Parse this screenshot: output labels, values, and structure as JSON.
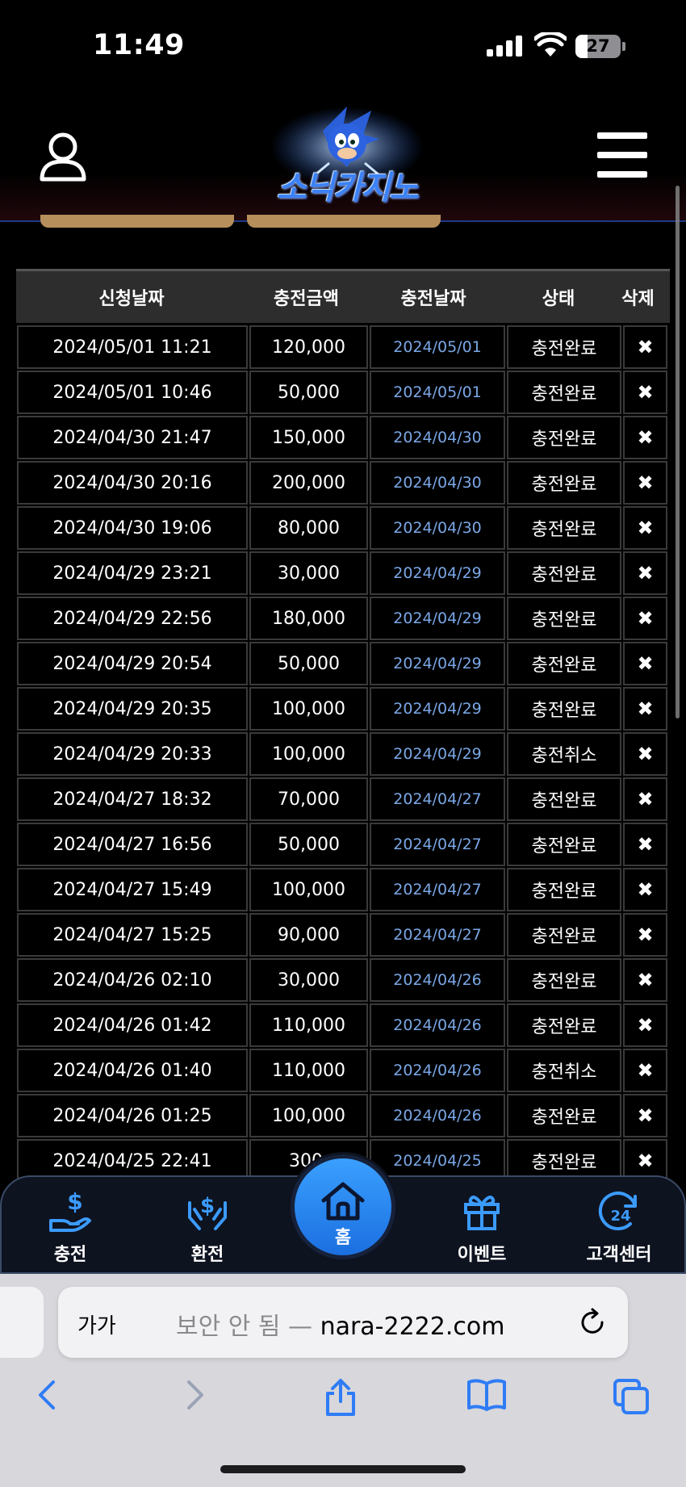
{
  "status_bar": {
    "time": "11:49",
    "battery": "27",
    "battery_level": 0.27
  },
  "header": {
    "logo_text": "소닉카지노"
  },
  "table": {
    "columns": [
      "신청날짜",
      "충전금액",
      "충전날짜",
      "상태",
      "삭제"
    ],
    "delete_symbol": "✖",
    "rows": [
      [
        "2024/05/01 11:21",
        "120,000",
        "2024/05/01",
        "충전완료"
      ],
      [
        "2024/05/01 10:46",
        "50,000",
        "2024/05/01",
        "충전완료"
      ],
      [
        "2024/04/30 21:47",
        "150,000",
        "2024/04/30",
        "충전완료"
      ],
      [
        "2024/04/30 20:16",
        "200,000",
        "2024/04/30",
        "충전완료"
      ],
      [
        "2024/04/30 19:06",
        "80,000",
        "2024/04/30",
        "충전완료"
      ],
      [
        "2024/04/29 23:21",
        "30,000",
        "2024/04/29",
        "충전완료"
      ],
      [
        "2024/04/29 22:56",
        "180,000",
        "2024/04/29",
        "충전완료"
      ],
      [
        "2024/04/29 20:54",
        "50,000",
        "2024/04/29",
        "충전완료"
      ],
      [
        "2024/04/29 20:35",
        "100,000",
        "2024/04/29",
        "충전완료"
      ],
      [
        "2024/04/29 20:33",
        "100,000",
        "2024/04/29",
        "충전취소"
      ],
      [
        "2024/04/27 18:32",
        "70,000",
        "2024/04/27",
        "충전완료"
      ],
      [
        "2024/04/27 16:56",
        "50,000",
        "2024/04/27",
        "충전완료"
      ],
      [
        "2024/04/27 15:49",
        "100,000",
        "2024/04/27",
        "충전완료"
      ],
      [
        "2024/04/27 15:25",
        "90,000",
        "2024/04/27",
        "충전완료"
      ],
      [
        "2024/04/26 02:10",
        "30,000",
        "2024/04/26",
        "충전완료"
      ],
      [
        "2024/04/26 01:42",
        "110,000",
        "2024/04/26",
        "충전완료"
      ],
      [
        "2024/04/26 01:40",
        "110,000",
        "2024/04/26",
        "충전취소"
      ],
      [
        "2024/04/26 01:25",
        "100,000",
        "2024/04/26",
        "충전완료"
      ],
      [
        "2024/04/25 22:41",
        "300,",
        "2024/04/25",
        "충전완료"
      ]
    ]
  },
  "bottom_nav": {
    "items": [
      {
        "label": "충전",
        "icon": "hand-dollar-icon"
      },
      {
        "label": "환전",
        "icon": "hands-dollar-icon"
      },
      {
        "label": "홈",
        "icon": "home-icon"
      },
      {
        "label": "이벤트",
        "icon": "gift-icon"
      },
      {
        "label": "고객센터",
        "icon": "support-24-icon"
      }
    ]
  },
  "browser": {
    "text_size_label": "가가",
    "insecure_label": "보안 안 됨 —",
    "domain": "nara-2222.com"
  },
  "colors": {
    "accent_blue": "#2f8cff",
    "date_blue": "#7aa7e6",
    "header_border": "#1e3a8a",
    "tab_gold": "#b58e5b"
  }
}
